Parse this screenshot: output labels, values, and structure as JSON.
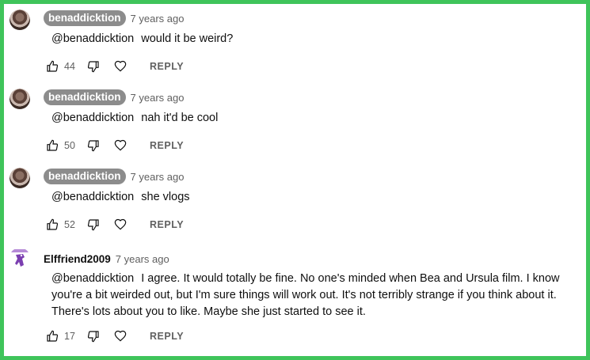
{
  "comments": [
    {
      "author": "benaddicktion",
      "author_style": "pill",
      "time": "7 years ago",
      "mention": "@benaddicktion",
      "text": "would it be weird?",
      "likes": "44",
      "reply_label": "REPLY"
    },
    {
      "author": "benaddicktion",
      "author_style": "pill",
      "time": "7 years ago",
      "mention": "@benaddicktion",
      "text": "nah it'd be cool",
      "likes": "50",
      "reply_label": "REPLY"
    },
    {
      "author": "benaddicktion",
      "author_style": "pill",
      "time": "7 years ago",
      "mention": "@benaddicktion",
      "text": "she vlogs",
      "likes": "52",
      "reply_label": "REPLY"
    },
    {
      "author": "Elffriend2009",
      "author_style": "plain",
      "time": "7 years ago",
      "mention": "@benaddicktion",
      "text": "I agree. It would totally be fine.  No one's minded when Bea and Ursula film.  I know you're a bit weirded out, but I'm sure things will work out. It's not terribly strange if you think about it.  There's lots about you to like. Maybe she just started to see it.",
      "likes": "17",
      "reply_label": "REPLY"
    }
  ],
  "colors": {
    "frame_border": "#3fc45a",
    "pill_background": "#8c8c8c",
    "secondary_text": "#606060"
  },
  "icons": [
    "thumb-up-icon",
    "thumb-down-icon",
    "heart-icon",
    "avatar-image"
  ]
}
